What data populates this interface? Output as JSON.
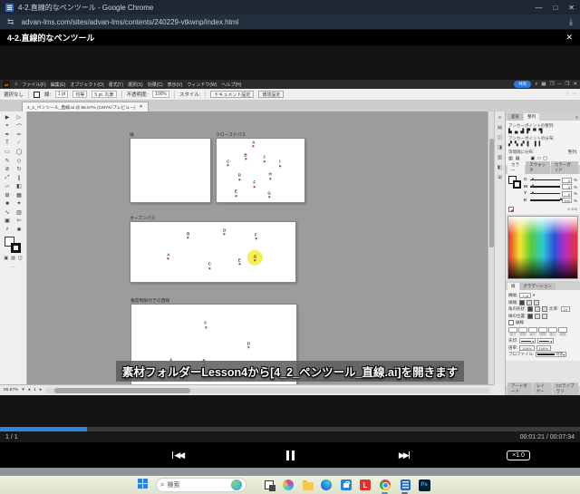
{
  "browser": {
    "title": "4-2.直線的なペンツール - Google Chrome",
    "minimize": "—",
    "maximize": "□",
    "close": "✕",
    "url": "advan-lms.com/sites/advan-lms/contents/240229-vtkwnp/index.html",
    "reload_glyph": "⇆",
    "download_glyph": "⤓"
  },
  "lesson": {
    "title": "4-2.直線的なペンツール",
    "close": "✕"
  },
  "ai": {
    "logo": "Ai",
    "home_glyph": "⌂",
    "menus": [
      "ファイル(F)",
      "編集(E)",
      "オブジェクト(O)",
      "書式(T)",
      "選択(S)",
      "効果(C)",
      "表示(V)",
      "ウィンドウ(W)",
      "ヘルプ(H)"
    ],
    "share": "共有",
    "control": {
      "selection": "選択なし",
      "stroke_label": "線:",
      "stroke_value": "1 pt",
      "profile_value": "均等",
      "brush_value": "5 pt. 丸筆",
      "opacity_label": "不透明度:",
      "opacity_value": "100%",
      "style_label": "スタイル:",
      "doc_setup": "ドキュメント設定",
      "preferences": "環境設定"
    },
    "doc_tab": {
      "title": "4_2_ペンツール_直線.ai @ 66.67% (CMYK/プレビュー)",
      "close": "✕"
    },
    "tools": [
      {
        "g": "▶",
        "n": "tool-selection"
      },
      {
        "g": "▷",
        "n": "tool-direct-selection"
      },
      {
        "g": "⌖",
        "n": "tool-magic-wand"
      },
      {
        "g": "⌒",
        "n": "tool-lasso"
      },
      {
        "g": "✒",
        "n": "tool-pen"
      },
      {
        "g": "✏",
        "n": "tool-curvature"
      },
      {
        "g": "T",
        "n": "tool-type"
      },
      {
        "g": "∕",
        "n": "tool-line-segment"
      },
      {
        "g": "▭",
        "n": "tool-rectangle"
      },
      {
        "g": "◯",
        "n": "tool-ellipse"
      },
      {
        "g": "✎",
        "n": "tool-paintbrush"
      },
      {
        "g": "◇",
        "n": "tool-shaper"
      },
      {
        "g": "⊘",
        "n": "tool-eraser"
      },
      {
        "g": "↻",
        "n": "tool-rotate"
      },
      {
        "g": "⤢",
        "n": "tool-scale"
      },
      {
        "g": "∥",
        "n": "tool-width"
      },
      {
        "g": "▱",
        "n": "tool-free-transform"
      },
      {
        "g": "◧",
        "n": "tool-shape-builder"
      },
      {
        "g": "⊞",
        "n": "tool-perspective-grid"
      },
      {
        "g": "▦",
        "n": "tool-mesh"
      },
      {
        "g": "■",
        "n": "tool-gradient"
      },
      {
        "g": "✦",
        "n": "tool-eyedropper"
      },
      {
        "g": "∿",
        "n": "tool-blend"
      },
      {
        "g": "▥",
        "n": "tool-symbol-sprayer"
      },
      {
        "g": "▣",
        "n": "tool-column-graph"
      },
      {
        "g": "✄",
        "n": "tool-artboard"
      },
      {
        "g": "⌕",
        "n": "tool-zoom"
      },
      {
        "g": "✱",
        "n": "tool-hand"
      }
    ],
    "panel_strip_icons": [
      "≡",
      "▤",
      "◫",
      "◨",
      "▥",
      "◧",
      "⊞"
    ],
    "panels": {
      "tab_transform": "変形",
      "tab_align": "整列",
      "align_anchor_label": "アンカーポイントの整列:",
      "align_icons": [
        "▙",
        "▄",
        "▟",
        "▛",
        "▀",
        "▜"
      ],
      "dist_anchor_label": "アンカーポイントの分布:",
      "dist_icons": [
        "▞",
        "▚",
        "▞",
        "▌",
        "▐",
        "▍"
      ],
      "dist_spacing_label": "等間隔に分布:",
      "align_to_label": "整列:",
      "color_tabs": [
        "カラー",
        "スウォッチ",
        "カラーガイド"
      ],
      "channels": [
        {
          "l": "C",
          "v": "0",
          "pos": 2
        },
        {
          "l": "M",
          "v": "0",
          "pos": 2
        },
        {
          "l": "Y",
          "v": "0",
          "pos": 2
        },
        {
          "l": "K",
          "v": "100",
          "pos": 96
        }
      ],
      "percent": "%",
      "stroke": {
        "tab": "線",
        "tab2": "グラデーション",
        "weight_label": "線幅:",
        "weight_value": "1 pt",
        "cap_label": "線端:",
        "corner_label": "角の形状:",
        "ratio_label": "比率:",
        "align_label": "線の位置:",
        "dash_label": "破線",
        "dash_fields": [
          "線分",
          "間隔",
          "線分",
          "間隔",
          "線分",
          "間隔"
        ],
        "arrow_label": "矢印:",
        "scale_label": "倍率:",
        "scale_v1": "100%",
        "scale_v2": "100%",
        "profile_label": "プロファイル:",
        "profile_value": "均等"
      },
      "bottom_tabs": [
        "アートボード",
        "レイヤー",
        "CCライブラリ"
      ]
    },
    "status": {
      "zoom": "66.67%",
      "artboard_nav": "1"
    },
    "artboards": {
      "ab1": {
        "label": "線"
      },
      "ab2": {
        "label": "クローズドパス",
        "points": [
          {
            "t": "A",
            "x": 42,
            "y": 8
          },
          {
            "t": "B",
            "x": 33,
            "y": 28
          },
          {
            "t": "J",
            "x": 54,
            "y": 32
          },
          {
            "t": "C",
            "x": 13,
            "y": 38
          },
          {
            "t": "I",
            "x": 72,
            "y": 39
          },
          {
            "t": "D",
            "x": 26,
            "y": 60
          },
          {
            "t": "H",
            "x": 61,
            "y": 59
          },
          {
            "t": "F",
            "x": 43,
            "y": 72
          },
          {
            "t": "E",
            "x": 22,
            "y": 86
          },
          {
            "t": "G",
            "x": 60,
            "y": 88
          }
        ]
      },
      "ab3": {
        "label": "オープンパス",
        "points": [
          {
            "t": "B",
            "x": 35,
            "y": 22
          },
          {
            "t": "D",
            "x": 57,
            "y": 16
          },
          {
            "t": "F",
            "x": 76,
            "y": 24
          },
          {
            "t": "A",
            "x": 23,
            "y": 57
          },
          {
            "t": "C",
            "x": 48,
            "y": 73
          },
          {
            "t": "E",
            "x": 66,
            "y": 66
          },
          {
            "t": "G",
            "x": 75.5,
            "y": 60,
            "hl": true
          }
        ]
      },
      "ab4": {
        "label": "角度制限付きの直線",
        "points": [
          {
            "t": "C",
            "x": 45,
            "y": 24
          },
          {
            "t": "D",
            "x": 71,
            "y": 48
          },
          {
            "t": "A",
            "x": 24,
            "y": 68
          },
          {
            "t": "B",
            "x": 44,
            "y": 69
          }
        ]
      }
    }
  },
  "subtitle": "素材フォルダーLesson4から[4_2_ペンツール_直線.ai]を開きます",
  "player": {
    "page": "1 / 1",
    "time": "00:01:21 / 00:07:34",
    "progress_pct": 15,
    "speed": "×1.0"
  },
  "taskbar": {
    "search_placeholder": "検索"
  }
}
